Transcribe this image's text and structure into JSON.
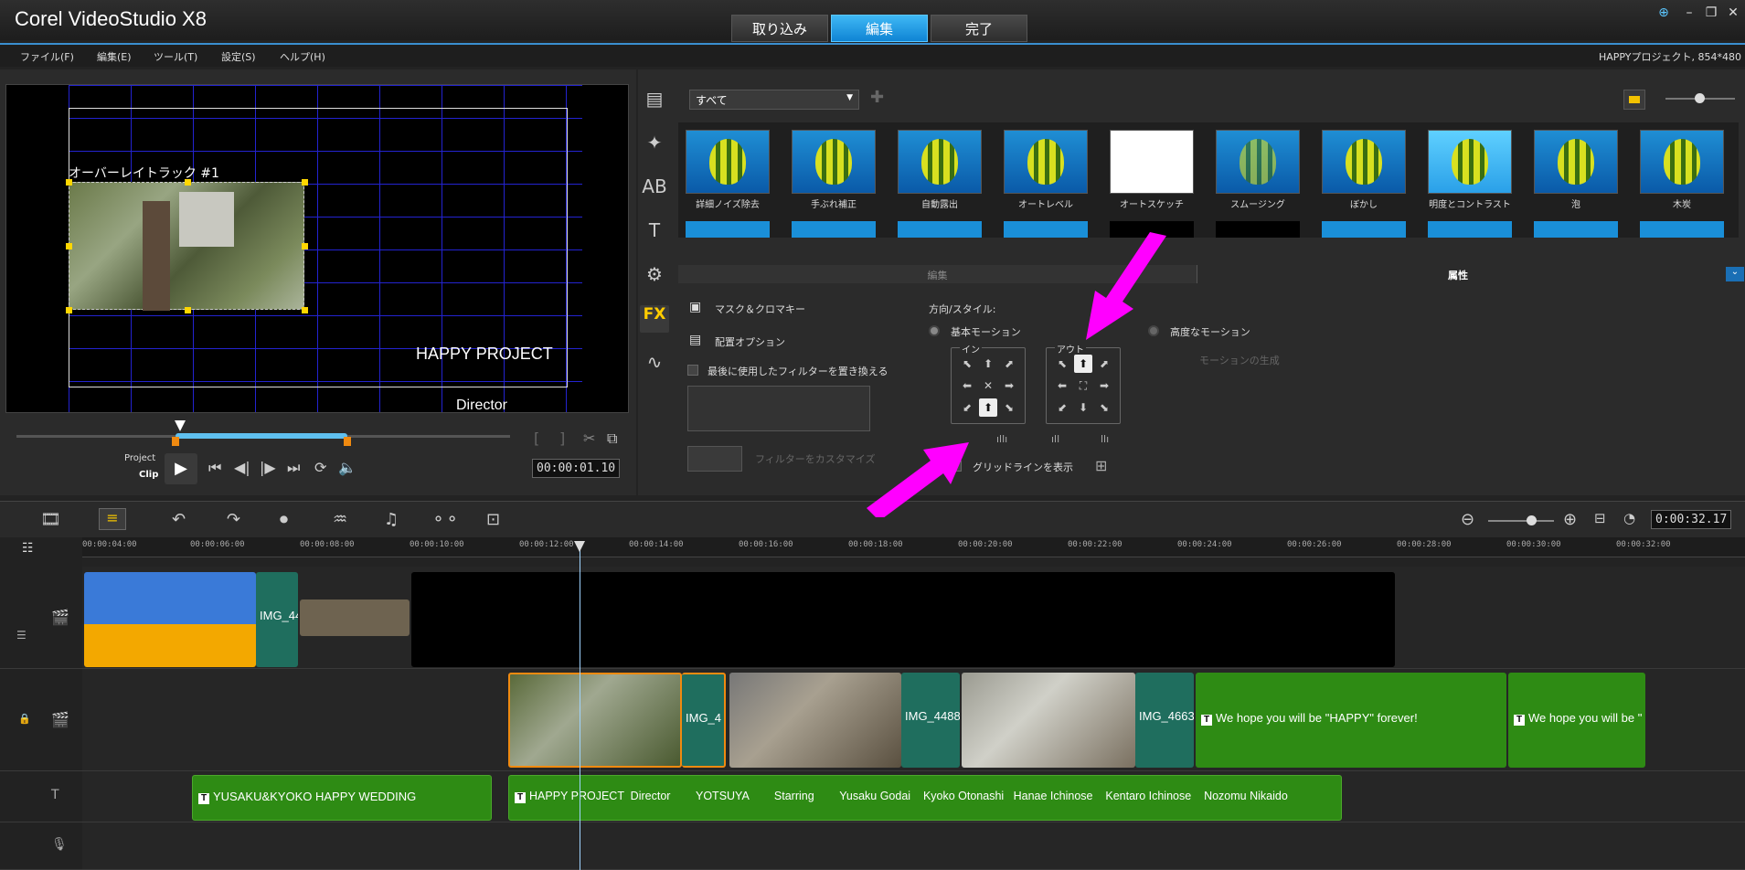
{
  "app": {
    "title": "Corel VideoStudio X8",
    "project_info": "HAPPYプロジェクト, 854*480"
  },
  "mode_tabs": [
    {
      "label": "取り込み"
    },
    {
      "label": "編集"
    },
    {
      "label": "完了"
    }
  ],
  "menu": [
    {
      "label": "ファイル(F)"
    },
    {
      "label": "編集(E)"
    },
    {
      "label": "ツール(T)"
    },
    {
      "label": "設定(S)"
    },
    {
      "label": "ヘルプ(H)"
    }
  ],
  "preview": {
    "overlay_label": "オーバーレイトラック #1",
    "text1": "HAPPY PROJECT",
    "text2": "Director",
    "project_label": "Project",
    "clip_label": "Clip",
    "timecode": "00:00:01.10"
  },
  "library": {
    "category": "すべて",
    "thumbnails": [
      {
        "label": "詳細ノイズ除去"
      },
      {
        "label": "手ぶれ補正"
      },
      {
        "label": "自動露出"
      },
      {
        "label": "オートレベル"
      },
      {
        "label": "オートスケッチ"
      },
      {
        "label": "スムージング"
      },
      {
        "label": "ぼかし"
      },
      {
        "label": "明度とコントラスト"
      },
      {
        "label": "泡"
      },
      {
        "label": "木炭"
      }
    ]
  },
  "options_tabs": {
    "edit": "編集",
    "attributes": "属性"
  },
  "attributes": {
    "mask": "マスク＆クロマキー",
    "placement": "配置オプション",
    "replace_filter": "最後に使用したフィルターを置き換える",
    "customize_filter": "フィルターをカスタマイズ",
    "direction_style": "方向/スタイル:",
    "basic_motion": "基本モーション",
    "advanced_motion": "高度なモーション",
    "generate_motion": "モーションの生成",
    "in_label": "イン",
    "out_label": "アウト",
    "show_gridlines": "グリッドラインを表示"
  },
  "timeline": {
    "total_time": "0:00:32.17",
    "ruler": [
      "00:00:04:00",
      "00:00:06:00",
      "00:00:08:00",
      "00:00:10:00",
      "00:00:12:00",
      "00:00:14:00",
      "00:00:16:00",
      "00:00:18:00",
      "00:00:20:00",
      "00:00:22:00",
      "00:00:24:00",
      "00:00:26:00",
      "00:00:28:00",
      "00:00:30:00",
      "00:00:32:00"
    ],
    "video_clip1": "IMG_44",
    "overlay_clips": [
      "IMG_4",
      "IMG_4488",
      "IMG_4663"
    ],
    "overlay_titles": [
      "We hope you will be \"HAPPY\" forever!",
      "We hope you will be \""
    ],
    "title_track": [
      "YUSAKU&KYOKO HAPPY WEDDING",
      "HAPPY PROJECT  Director        YOTSUYA        Starring        Yusaku Godai    Kyoko Otonashi   Hanae Ichinose    Kentaro Ichinose    Nozomu Nikaido"
    ]
  }
}
